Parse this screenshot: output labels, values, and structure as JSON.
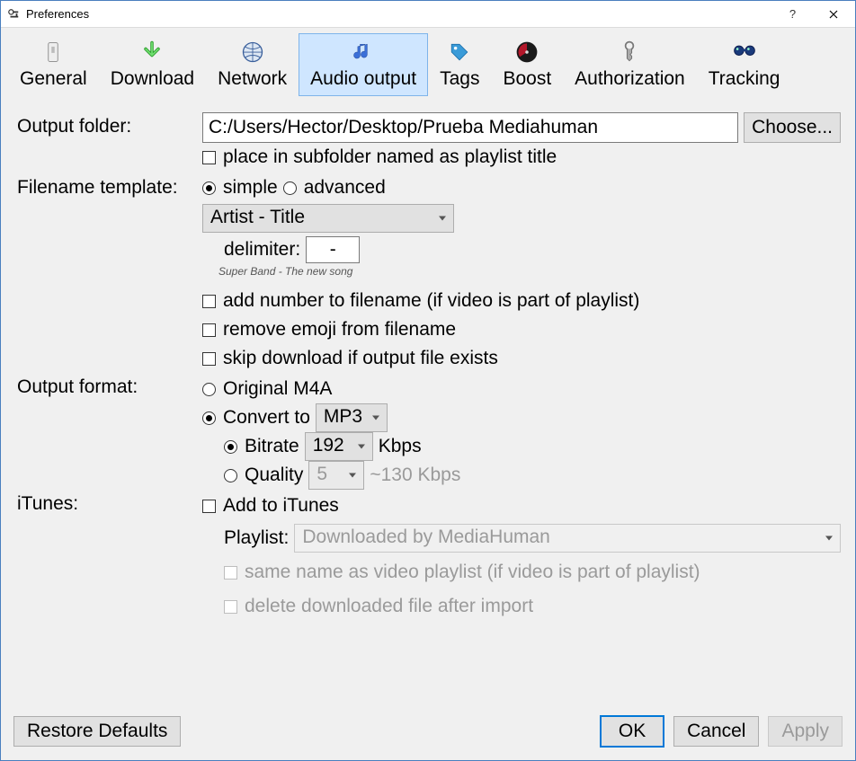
{
  "window": {
    "title": "Preferences"
  },
  "tabs": [
    {
      "label": "General"
    },
    {
      "label": "Download"
    },
    {
      "label": "Network"
    },
    {
      "label": "Audio output"
    },
    {
      "label": "Tags"
    },
    {
      "label": "Boost"
    },
    {
      "label": "Authorization"
    },
    {
      "label": "Tracking"
    }
  ],
  "labels": {
    "output_folder": "Output folder:",
    "filename_template": "Filename template:",
    "output_format": "Output format:",
    "itunes": "iTunes:"
  },
  "output_folder": {
    "value": "C:/Users/Hector/Desktop/Prueba Mediahuman",
    "choose": "Choose...",
    "subfolder": "place in subfolder named as playlist title"
  },
  "filename_template": {
    "simple": "simple",
    "advanced": "advanced",
    "template_value": "Artist - Title",
    "delimiter_label": "delimiter:",
    "delimiter_value": "-",
    "example": "Super Band - The new song",
    "add_number": "add number to filename (if video is part of playlist)",
    "remove_emoji": "remove emoji from filename",
    "skip_exists": "skip download if output file exists"
  },
  "output_format": {
    "original": "Original M4A",
    "convert_to": "Convert to",
    "format_value": "MP3",
    "bitrate_label": "Bitrate",
    "bitrate_value": "192",
    "bitrate_unit": "Kbps",
    "quality_label": "Quality",
    "quality_value": "5",
    "quality_est": "~130 Kbps"
  },
  "itunes": {
    "add": "Add to iTunes",
    "playlist_label": "Playlist:",
    "playlist_value": "Downloaded by MediaHuman",
    "same_name": "same name as video playlist (if video is part of playlist)",
    "delete_after": "delete downloaded file after import"
  },
  "footer": {
    "restore": "Restore Defaults",
    "ok": "OK",
    "cancel": "Cancel",
    "apply": "Apply"
  }
}
